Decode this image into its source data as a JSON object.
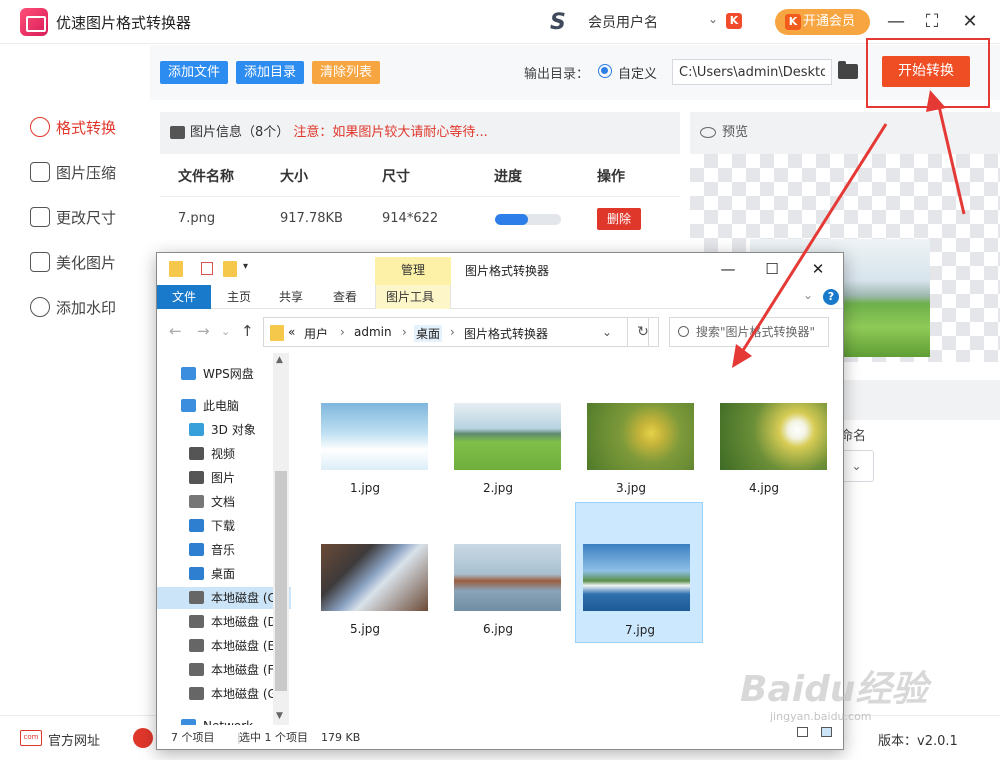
{
  "app": {
    "title": "优速图片格式转换器",
    "user_name": "会员用户名",
    "vip_button": "开通会员",
    "vip_glyph": "K"
  },
  "sidebar": {
    "items": [
      {
        "label": "格式转换",
        "icon": "convert-icon"
      },
      {
        "label": "图片压缩",
        "icon": "compress-icon"
      },
      {
        "label": "更改尺寸",
        "icon": "resize-icon"
      },
      {
        "label": "美化图片",
        "icon": "beautify-icon"
      },
      {
        "label": "添加水印",
        "icon": "watermark-icon"
      }
    ]
  },
  "toolbar": {
    "add_file": "添加文件",
    "add_dir": "添加目录",
    "clear_list": "清除列表",
    "output_label": "输出目录：",
    "custom_option": "自定义",
    "output_path": "C:\\Users\\admin\\Desktop",
    "start_button": "开始转换"
  },
  "list": {
    "info_title": "图片信息（8个）",
    "info_warning": "注意：如果图片较大请耐心等待...",
    "headers": [
      "文件名称",
      "大小",
      "尺寸",
      "进度",
      "操作"
    ],
    "rows": [
      {
        "name": "7.png",
        "size": "917.78KB",
        "dimensions": "914*622",
        "progress": 0.5,
        "action": "删除"
      }
    ]
  },
  "preview": {
    "title": "预览",
    "name_label": "命名",
    "select_caret": "⌄"
  },
  "bottom": {
    "website": "官方网址",
    "website_icon_text": "com",
    "version": "版本：v2.0.1"
  },
  "explorer": {
    "manage_tab": "管理",
    "title": "图片格式转换器",
    "ribbon_tabs": [
      "文件",
      "主页",
      "共享",
      "查看",
      "图片工具"
    ],
    "help": "?",
    "address": [
      "«",
      "用户",
      "admin",
      "桌面",
      "图片格式转换器"
    ],
    "search_placeholder": "搜索\"图片格式转换器\"",
    "nav_items": [
      {
        "label": "WPS网盘",
        "color": "#3b8ede"
      },
      {
        "label": "此电脑",
        "color": "#3b8ede"
      },
      {
        "label": "3D 对象",
        "color": "#37a0da"
      },
      {
        "label": "视频",
        "color": "#555555"
      },
      {
        "label": "图片",
        "color": "#555555"
      },
      {
        "label": "文档",
        "color": "#777777"
      },
      {
        "label": "下载",
        "color": "#2f7fd1"
      },
      {
        "label": "音乐",
        "color": "#2f7fd1"
      },
      {
        "label": "桌面",
        "color": "#2f7fd1"
      },
      {
        "label": "本地磁盘 (C",
        "color": "#666666"
      },
      {
        "label": "本地磁盘 (D",
        "color": "#666666"
      },
      {
        "label": "本地磁盘 (E",
        "color": "#666666"
      },
      {
        "label": "本地磁盘 (F",
        "color": "#666666"
      },
      {
        "label": "本地磁盘 (G",
        "color": "#666666"
      },
      {
        "label": "Network",
        "color": "#3b8ede"
      }
    ],
    "files": [
      {
        "name": "1.jpg"
      },
      {
        "name": "2.jpg"
      },
      {
        "name": "3.jpg"
      },
      {
        "name": "4.jpg"
      },
      {
        "name": "5.jpg"
      },
      {
        "name": "6.jpg"
      },
      {
        "name": "7.jpg"
      }
    ],
    "status": {
      "count": "7 个项目",
      "selected": "选中 1 个项目",
      "size": "179 KB"
    }
  },
  "watermark": {
    "text": "Baidu经验",
    "sub": "jingyan.baidu.com"
  },
  "colors": {
    "accent_red": "#ef4d24",
    "blue": "#2d7ee8",
    "orange": "#f6a540",
    "annotation_red": "#e53935"
  }
}
